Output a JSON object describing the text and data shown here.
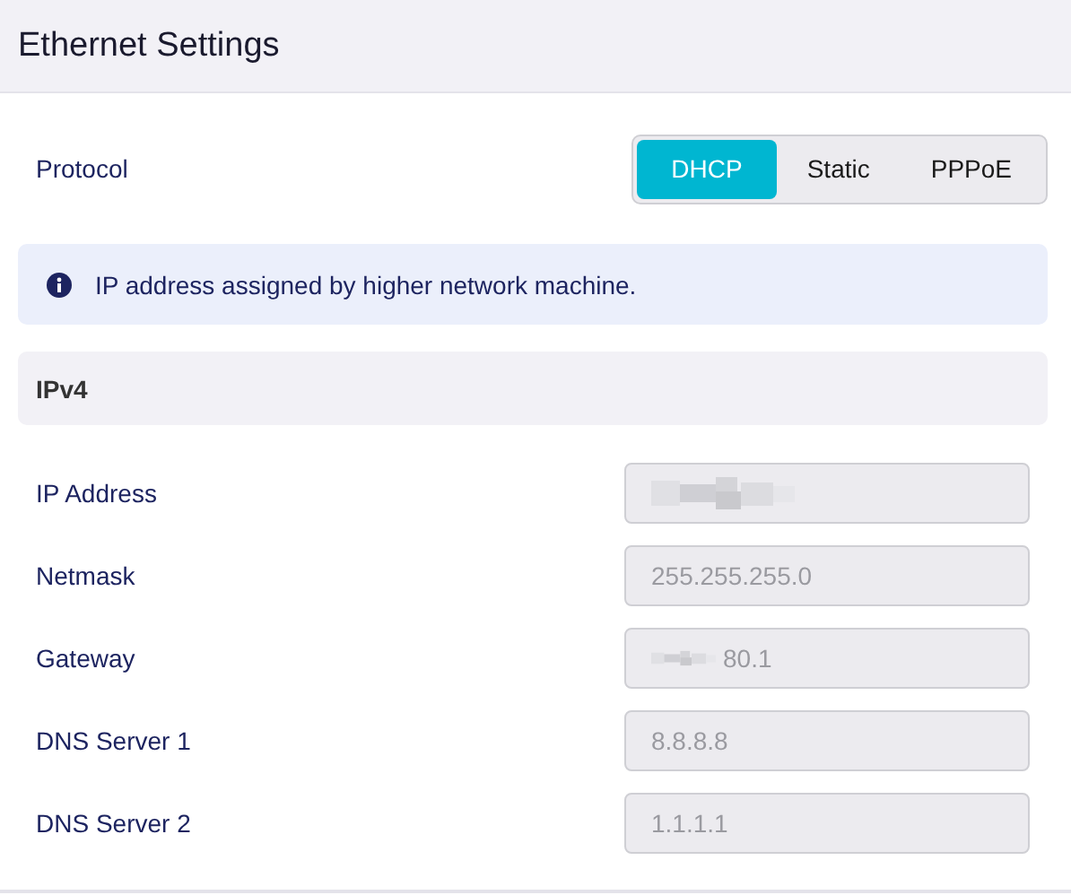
{
  "header": {
    "title": "Ethernet Settings"
  },
  "protocol": {
    "label": "Protocol",
    "options": [
      {
        "label": "DHCP",
        "selected": true
      },
      {
        "label": "Static",
        "selected": false
      },
      {
        "label": "PPPoE",
        "selected": false
      }
    ]
  },
  "notice": {
    "text": "IP address assigned by higher network machine."
  },
  "section": {
    "title": "IPv4"
  },
  "fields": [
    {
      "label": "IP Address",
      "disabled": true,
      "redacted": true
    },
    {
      "label": "Netmask",
      "value": "255.255.255.0",
      "disabled": true,
      "redacted": false
    },
    {
      "label": "Gateway",
      "value": "80.1",
      "disabled": true,
      "redacted": true
    },
    {
      "label": "DNS Server 1",
      "value": "8.8.8.8",
      "disabled": true,
      "redacted": false
    },
    {
      "label": "DNS Server 2",
      "value": "1.1.1.1",
      "disabled": true,
      "redacted": false
    }
  ]
}
